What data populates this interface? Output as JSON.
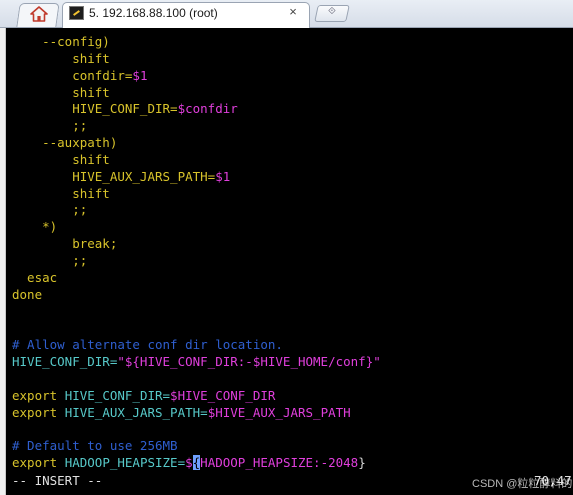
{
  "window": {
    "tab_title": "5. 192.168.88.100 (root)",
    "close_glyph": "×",
    "new_tab_glyph": "⟐",
    "home_icon": "home-icon",
    "session_icon": "terminal-session-icon"
  },
  "colors": {
    "background": "#000000",
    "yellow": "#d8c32b",
    "magenta": "#e03fdc",
    "cyan": "#57c9c9",
    "blue": "#2f5fd0",
    "cursor": "#6fa0ff"
  },
  "editor": {
    "lines": [
      [
        {
          "t": "    --config)",
          "c": "y"
        }
      ],
      [
        {
          "t": "        shift",
          "c": "y"
        }
      ],
      [
        {
          "t": "        confdir=",
          "c": "y"
        },
        {
          "t": "$1",
          "c": "m"
        }
      ],
      [
        {
          "t": "        shift",
          "c": "y"
        }
      ],
      [
        {
          "t": "        HIVE_CONF_DIR=",
          "c": "y"
        },
        {
          "t": "$confdir",
          "c": "m"
        }
      ],
      [
        {
          "t": "        ;;",
          "c": "y"
        }
      ],
      [
        {
          "t": "    --auxpath)",
          "c": "y"
        }
      ],
      [
        {
          "t": "        shift",
          "c": "y"
        }
      ],
      [
        {
          "t": "        HIVE_AUX_JARS_PATH=",
          "c": "y"
        },
        {
          "t": "$1",
          "c": "m"
        }
      ],
      [
        {
          "t": "        shift",
          "c": "y"
        }
      ],
      [
        {
          "t": "        ;;",
          "c": "y"
        }
      ],
      [
        {
          "t": "    *)",
          "c": "y"
        }
      ],
      [
        {
          "t": "        break;",
          "c": "y"
        }
      ],
      [
        {
          "t": "        ;;",
          "c": "y"
        }
      ],
      [
        {
          "t": "  esac",
          "c": "y"
        }
      ],
      [
        {
          "t": "done",
          "c": "y"
        }
      ],
      [],
      [],
      [
        {
          "t": "# Allow alternate conf dir location.",
          "c": "b"
        }
      ],
      [
        {
          "t": "HIVE_CONF_DIR=",
          "c": "c"
        },
        {
          "t": "\"${HIVE_CONF_DIR:-$HIVE_HOME/conf}\"",
          "c": "m"
        }
      ],
      [],
      [
        {
          "t": "export ",
          "c": "y"
        },
        {
          "t": "HIVE_CONF_DIR=",
          "c": "c"
        },
        {
          "t": "$HIVE_CONF_DIR",
          "c": "m"
        }
      ],
      [
        {
          "t": "export ",
          "c": "y"
        },
        {
          "t": "HIVE_AUX_JARS_PATH=",
          "c": "c"
        },
        {
          "t": "$HIVE_AUX_JARS_PATH",
          "c": "m"
        }
      ],
      [],
      [
        {
          "t": "# Default to use 256MB",
          "c": "b"
        }
      ],
      [
        {
          "t": "export ",
          "c": "y"
        },
        {
          "t": "HADOOP_HEAPSIZE=",
          "c": "c"
        },
        {
          "t": "$",
          "c": "m"
        },
        {
          "t": "{",
          "c": "cursor"
        },
        {
          "t": "HADOOP_HEAPSIZE:-2048",
          "c": "m"
        },
        {
          "t": "}",
          "c": "w"
        }
      ]
    ],
    "mode": "-- INSERT --",
    "position": "70,47"
  },
  "watermark": "CSDN @粒粒醇料的"
}
